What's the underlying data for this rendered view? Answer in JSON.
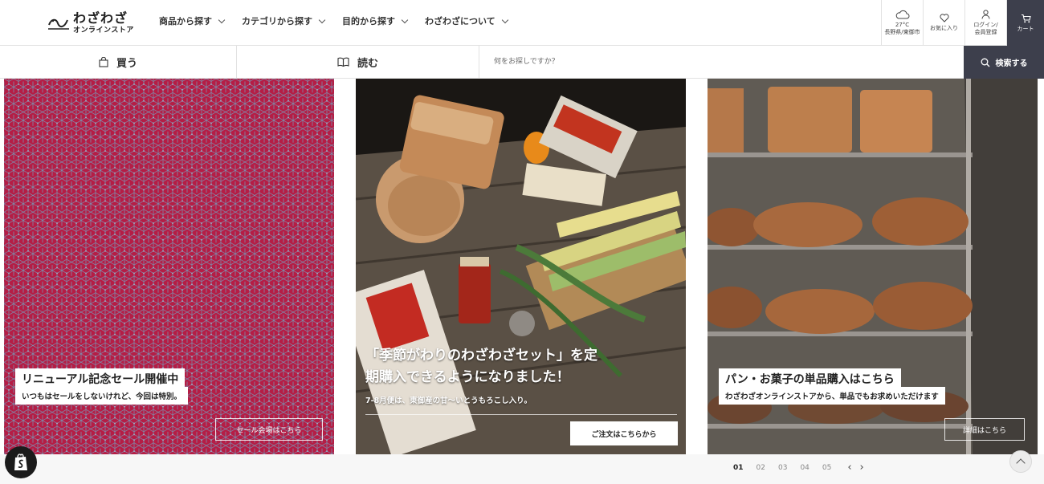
{
  "header": {
    "logo_main": "わざわざ",
    "logo_sub": "オンラインストア",
    "nav": [
      {
        "label": "商品から探す"
      },
      {
        "label": "カテゴリから探す"
      },
      {
        "label": "目的から探す"
      },
      {
        "label": "わざわざについて"
      }
    ],
    "weather": {
      "temp": "27°C",
      "location": "長野県/東御市"
    },
    "favorites_label": "お気に入り",
    "login_label_1": "ログイン/",
    "login_label_2": "会員登録",
    "cart_label": "カート"
  },
  "subbar": {
    "tab_buy": "買う",
    "tab_read": "読む",
    "search_placeholder": "何をお探しですか？",
    "search_button": "検索する"
  },
  "slides": [
    {
      "title": "リニューアル記念セール開催中",
      "subtitle": "いつもはセールをしないけれど、今回は特別。",
      "cta": "セール会場はこちら"
    },
    {
      "title_line1": "「季節がわりのわざわざセット」を定",
      "title_line2": "期購入できるようになりました！",
      "subtitle": "7-8月便は、東御産の甘〜いとうもろこし入り。",
      "cta": "ご注文はこちらから"
    },
    {
      "title": "パン・お菓子の単品購入はこちら",
      "subtitle": "わざわざオンラインストアから、単品でもお求めいただけます",
      "cta": "詳細はこちら"
    }
  ],
  "pager": {
    "pages": [
      "01",
      "02",
      "03",
      "04",
      "05"
    ],
    "active": "01",
    "prev": "‹",
    "next": "›"
  },
  "colors": {
    "nav_dark": "#3d3f4c",
    "sale_red": "#b51d45",
    "pattern_blue": "#6fa6c4"
  }
}
